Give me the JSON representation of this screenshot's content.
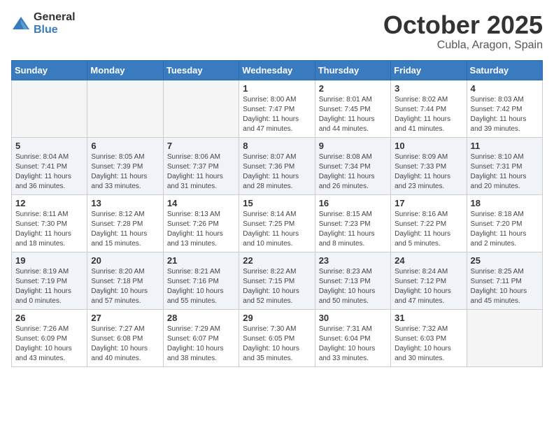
{
  "header": {
    "logo_general": "General",
    "logo_blue": "Blue",
    "month": "October 2025",
    "location": "Cubla, Aragon, Spain"
  },
  "weekdays": [
    "Sunday",
    "Monday",
    "Tuesday",
    "Wednesday",
    "Thursday",
    "Friday",
    "Saturday"
  ],
  "weeks": [
    {
      "alt": false,
      "days": [
        {
          "num": "",
          "info": ""
        },
        {
          "num": "",
          "info": ""
        },
        {
          "num": "",
          "info": ""
        },
        {
          "num": "1",
          "info": "Sunrise: 8:00 AM\nSunset: 7:47 PM\nDaylight: 11 hours\nand 47 minutes."
        },
        {
          "num": "2",
          "info": "Sunrise: 8:01 AM\nSunset: 7:45 PM\nDaylight: 11 hours\nand 44 minutes."
        },
        {
          "num": "3",
          "info": "Sunrise: 8:02 AM\nSunset: 7:44 PM\nDaylight: 11 hours\nand 41 minutes."
        },
        {
          "num": "4",
          "info": "Sunrise: 8:03 AM\nSunset: 7:42 PM\nDaylight: 11 hours\nand 39 minutes."
        }
      ]
    },
    {
      "alt": true,
      "days": [
        {
          "num": "5",
          "info": "Sunrise: 8:04 AM\nSunset: 7:41 PM\nDaylight: 11 hours\nand 36 minutes."
        },
        {
          "num": "6",
          "info": "Sunrise: 8:05 AM\nSunset: 7:39 PM\nDaylight: 11 hours\nand 33 minutes."
        },
        {
          "num": "7",
          "info": "Sunrise: 8:06 AM\nSunset: 7:37 PM\nDaylight: 11 hours\nand 31 minutes."
        },
        {
          "num": "8",
          "info": "Sunrise: 8:07 AM\nSunset: 7:36 PM\nDaylight: 11 hours\nand 28 minutes."
        },
        {
          "num": "9",
          "info": "Sunrise: 8:08 AM\nSunset: 7:34 PM\nDaylight: 11 hours\nand 26 minutes."
        },
        {
          "num": "10",
          "info": "Sunrise: 8:09 AM\nSunset: 7:33 PM\nDaylight: 11 hours\nand 23 minutes."
        },
        {
          "num": "11",
          "info": "Sunrise: 8:10 AM\nSunset: 7:31 PM\nDaylight: 11 hours\nand 20 minutes."
        }
      ]
    },
    {
      "alt": false,
      "days": [
        {
          "num": "12",
          "info": "Sunrise: 8:11 AM\nSunset: 7:30 PM\nDaylight: 11 hours\nand 18 minutes."
        },
        {
          "num": "13",
          "info": "Sunrise: 8:12 AM\nSunset: 7:28 PM\nDaylight: 11 hours\nand 15 minutes."
        },
        {
          "num": "14",
          "info": "Sunrise: 8:13 AM\nSunset: 7:26 PM\nDaylight: 11 hours\nand 13 minutes."
        },
        {
          "num": "15",
          "info": "Sunrise: 8:14 AM\nSunset: 7:25 PM\nDaylight: 11 hours\nand 10 minutes."
        },
        {
          "num": "16",
          "info": "Sunrise: 8:15 AM\nSunset: 7:23 PM\nDaylight: 11 hours\nand 8 minutes."
        },
        {
          "num": "17",
          "info": "Sunrise: 8:16 AM\nSunset: 7:22 PM\nDaylight: 11 hours\nand 5 minutes."
        },
        {
          "num": "18",
          "info": "Sunrise: 8:18 AM\nSunset: 7:20 PM\nDaylight: 11 hours\nand 2 minutes."
        }
      ]
    },
    {
      "alt": true,
      "days": [
        {
          "num": "19",
          "info": "Sunrise: 8:19 AM\nSunset: 7:19 PM\nDaylight: 11 hours\nand 0 minutes."
        },
        {
          "num": "20",
          "info": "Sunrise: 8:20 AM\nSunset: 7:18 PM\nDaylight: 10 hours\nand 57 minutes."
        },
        {
          "num": "21",
          "info": "Sunrise: 8:21 AM\nSunset: 7:16 PM\nDaylight: 10 hours\nand 55 minutes."
        },
        {
          "num": "22",
          "info": "Sunrise: 8:22 AM\nSunset: 7:15 PM\nDaylight: 10 hours\nand 52 minutes."
        },
        {
          "num": "23",
          "info": "Sunrise: 8:23 AM\nSunset: 7:13 PM\nDaylight: 10 hours\nand 50 minutes."
        },
        {
          "num": "24",
          "info": "Sunrise: 8:24 AM\nSunset: 7:12 PM\nDaylight: 10 hours\nand 47 minutes."
        },
        {
          "num": "25",
          "info": "Sunrise: 8:25 AM\nSunset: 7:11 PM\nDaylight: 10 hours\nand 45 minutes."
        }
      ]
    },
    {
      "alt": false,
      "days": [
        {
          "num": "26",
          "info": "Sunrise: 7:26 AM\nSunset: 6:09 PM\nDaylight: 10 hours\nand 43 minutes."
        },
        {
          "num": "27",
          "info": "Sunrise: 7:27 AM\nSunset: 6:08 PM\nDaylight: 10 hours\nand 40 minutes."
        },
        {
          "num": "28",
          "info": "Sunrise: 7:29 AM\nSunset: 6:07 PM\nDaylight: 10 hours\nand 38 minutes."
        },
        {
          "num": "29",
          "info": "Sunrise: 7:30 AM\nSunset: 6:05 PM\nDaylight: 10 hours\nand 35 minutes."
        },
        {
          "num": "30",
          "info": "Sunrise: 7:31 AM\nSunset: 6:04 PM\nDaylight: 10 hours\nand 33 minutes."
        },
        {
          "num": "31",
          "info": "Sunrise: 7:32 AM\nSunset: 6:03 PM\nDaylight: 10 hours\nand 30 minutes."
        },
        {
          "num": "",
          "info": ""
        }
      ]
    }
  ]
}
